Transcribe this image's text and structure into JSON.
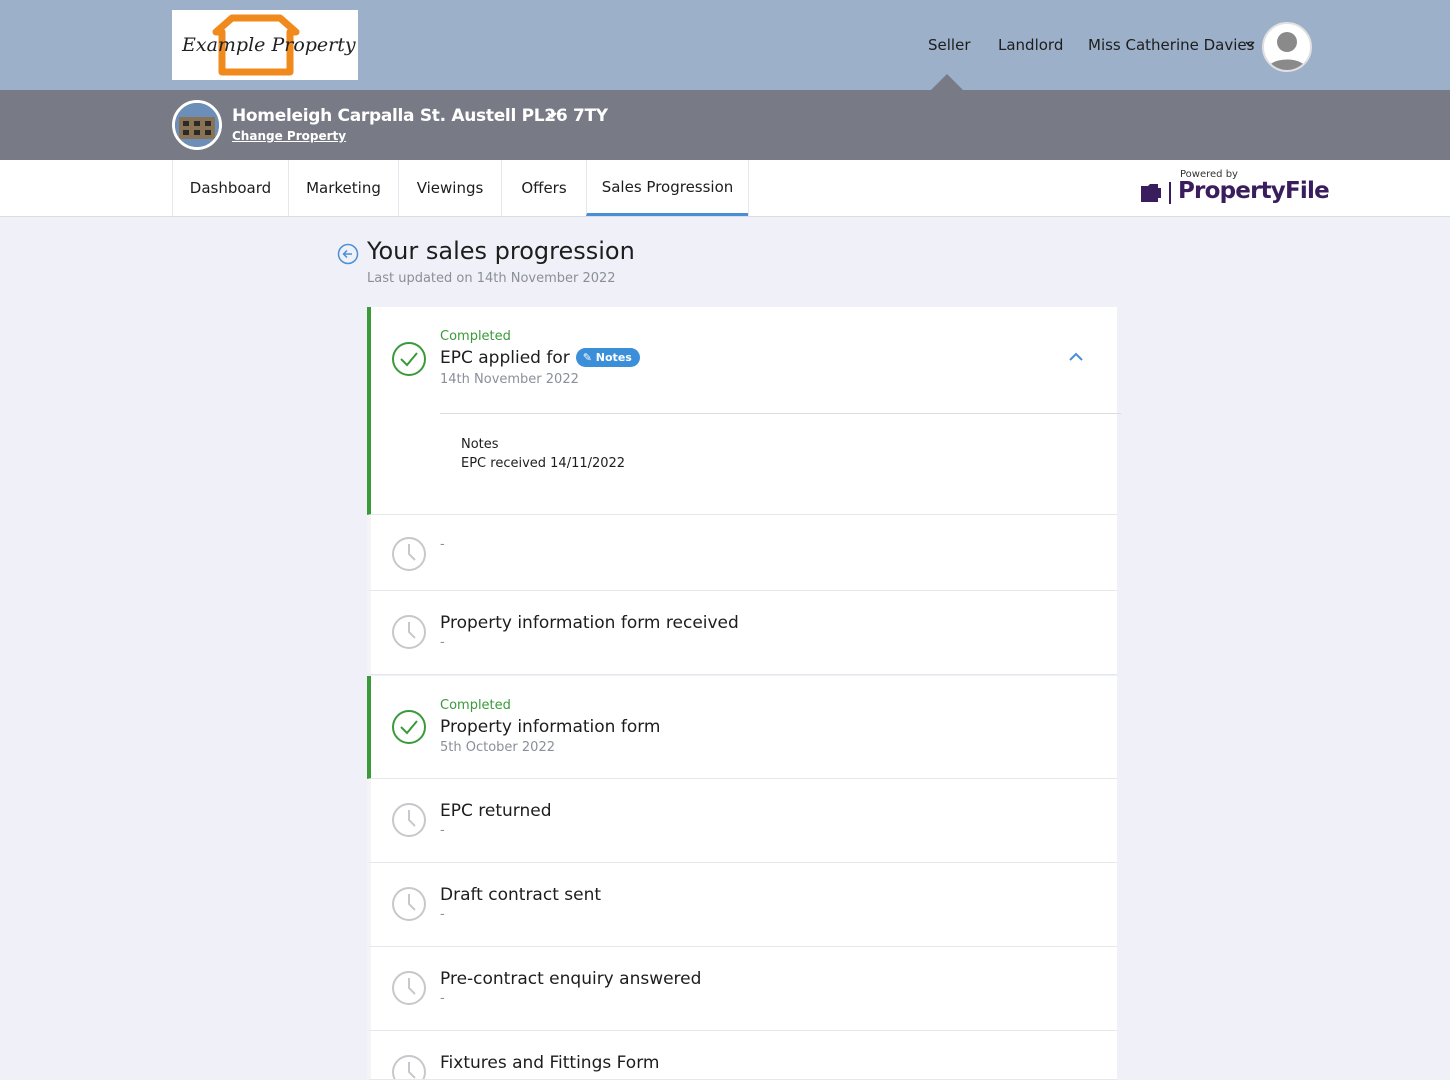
{
  "brand": {
    "logo_text": "Example Property",
    "powered_by": "Powered by",
    "provider": "PropertyFile"
  },
  "top_nav": {
    "seller": "Seller",
    "landlord": "Landlord",
    "user_name": "Miss Catherine Davies"
  },
  "property": {
    "address": "Homeleigh Carpalla St. Austell PL26 7TY",
    "change_link": "Change Property"
  },
  "tabs": [
    {
      "label": "Dashboard"
    },
    {
      "label": "Marketing"
    },
    {
      "label": "Viewings"
    },
    {
      "label": "Offers"
    },
    {
      "label": "Sales Progression",
      "active": true
    }
  ],
  "page": {
    "title": "Your sales progression",
    "subtitle": "Last updated on 14th November 2022"
  },
  "steps": [
    {
      "status": "Completed",
      "title": "EPC applied for",
      "badge": "Notes",
      "date": "14th November 2022",
      "notes_label": "Notes",
      "notes_text": "EPC received 14/11/2022"
    },
    {
      "status": "",
      "title": "",
      "date": "-"
    },
    {
      "status": "",
      "title": "Property information form received",
      "date": "-"
    },
    {
      "status": "Completed",
      "title": "Property information form",
      "date": "5th October 2022"
    },
    {
      "status": "",
      "title": "EPC returned",
      "date": "-"
    },
    {
      "status": "",
      "title": "Draft contract sent",
      "date": "-"
    },
    {
      "status": "",
      "title": "Pre-contract enquiry answered",
      "date": "-"
    },
    {
      "status": "",
      "title": "Fixtures and Fittings Form",
      "date": ""
    }
  ],
  "colors": {
    "header": "#9cb0c9",
    "property_bar": "#787a85",
    "accent": "#4a8fd6",
    "completed": "#3a9a3a",
    "badge": "#3b8fd8"
  }
}
